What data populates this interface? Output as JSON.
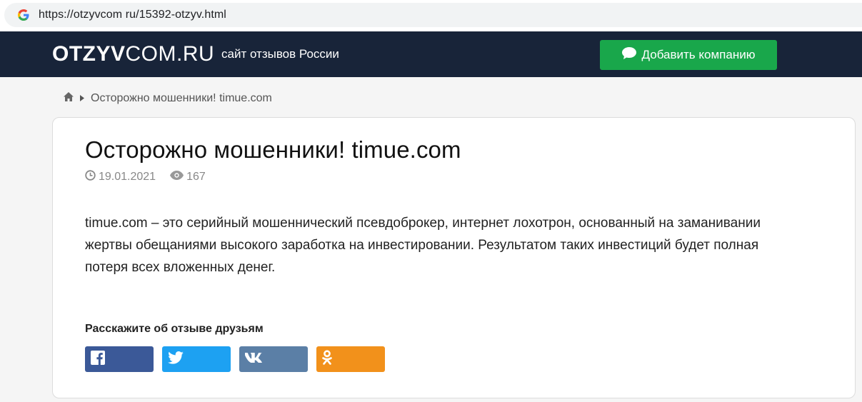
{
  "browser": {
    "url": "https://otzyvcom ru/15392-otzyv.html"
  },
  "header": {
    "logo_bold": "OTZYV",
    "logo_thin": "COM.RU",
    "tagline": "сайт отзывов России",
    "add_company_label": "Добавить компанию"
  },
  "breadcrumb": {
    "current": "Осторожно мошенники! timue.com"
  },
  "article": {
    "title": "Осторожно мошенники! timue.com",
    "date": "19.01.2021",
    "views": "167",
    "body": "timue.com – это серийный мошеннический псевдоброкер, интернет лохотрон, основанный на заманивании жертвы обещаниями высокого заработка на инвестировании. Результатом таких инвестиций будет полная потеря всех вложенных денег."
  },
  "share": {
    "label": "Расскажите об отзыве друзьям",
    "buttons": [
      {
        "name": "facebook",
        "icon": "facebook-icon",
        "color": "#3b5998"
      },
      {
        "name": "twitter",
        "icon": "twitter-icon",
        "color": "#1da1f2"
      },
      {
        "name": "vk",
        "icon": "vk-icon",
        "color": "#5b7fa6"
      },
      {
        "name": "odnoklassniki",
        "icon": "odnoklassniki-icon",
        "color": "#f2911b"
      }
    ]
  },
  "colors": {
    "header_bg": "#182439",
    "add_button": "#19a74b"
  }
}
